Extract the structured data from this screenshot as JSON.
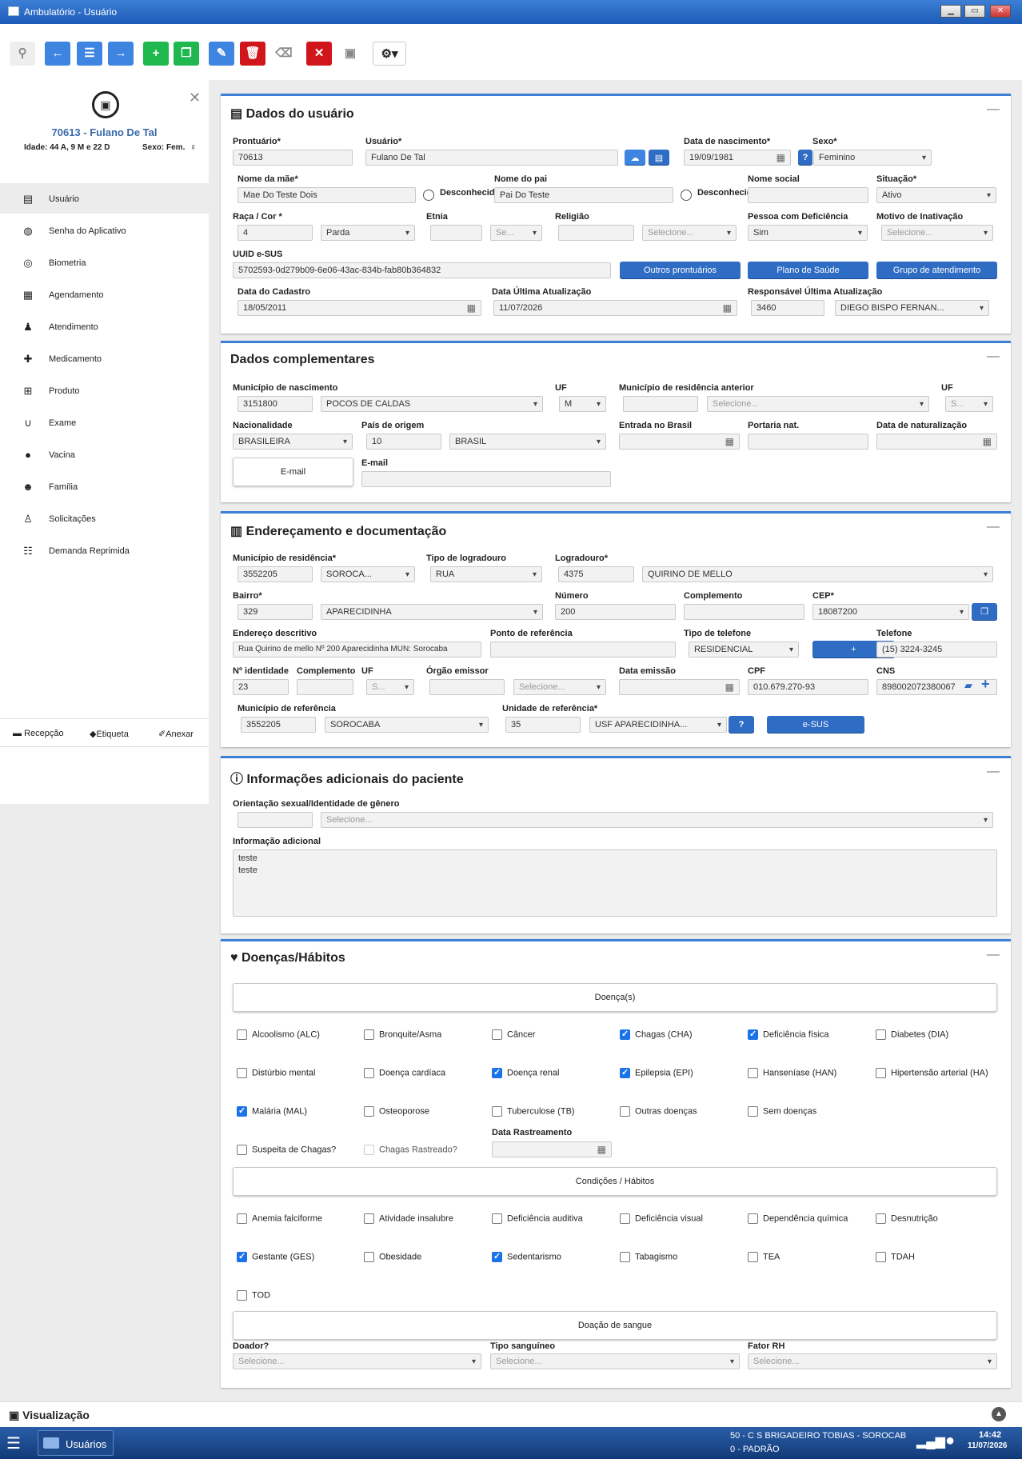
{
  "window": {
    "title": "Ambulatório - Usuário"
  },
  "patient": {
    "header": "70613 - Fulano De Tal",
    "age": "Idade: 44 A, 9 M e 22 D",
    "sex": "Sexo: Fem."
  },
  "sidebar": {
    "items": [
      "Usuário",
      "Senha do Aplicativo",
      "Biometria",
      "Agendamento",
      "Atendimento",
      "Medicamento",
      "Produto",
      "Exame",
      "Vacina",
      "Família",
      "Solicitações",
      "Demanda Reprimida"
    ],
    "bottom": [
      "Recepção",
      "Etiqueta",
      "Anexar"
    ]
  },
  "dados": {
    "title": "Dados do usuário",
    "labels": {
      "prontuario": "Prontuário*",
      "usuario": "Usuário*",
      "nasc": "Data de nascimento*",
      "sexo": "Sexo*",
      "mae": "Nome da mãe*",
      "pai": "Nome do pai",
      "social": "Nome social",
      "situacao": "Situação*",
      "raca": "Raça / Cor *",
      "etnia": "Etnia",
      "religiao": "Religião",
      "pcd": "Pessoa com Deficiência",
      "motivo": "Motivo de Inativação",
      "uuid": "UUID e-SUS",
      "cadastro": "Data do Cadastro",
      "ultima": "Data Última Atualização",
      "resp": "Responsável Última Atualização",
      "desc1": "Desconhecido",
      "desc2": "Desconhecido"
    },
    "values": {
      "prontuario": "70613",
      "usuario": "Fulano De Tal",
      "nasc": "19/09/1981",
      "sexo": "Feminino",
      "mae": "Mae Do Teste Dois",
      "pai": "Pai Do Teste",
      "situacao": "Ativo",
      "raca_code": "4",
      "raca": "Parda",
      "etnia_sel": "Se...",
      "religiao_sel": "Selecione...",
      "pcd": "Sim",
      "motivo": "Selecione...",
      "uuid": "5702593-0d279b09-6e06-43ac-834b-fab80b364832",
      "cadastro": "18/05/2011",
      "ultima": "11/07/2026",
      "resp_code": "3460",
      "resp": "DIEGO BISPO FERNAN..."
    },
    "buttons": {
      "outros": "Outros prontuários",
      "plano": "Plano de Saúde",
      "grupo": "Grupo de atendimento"
    }
  },
  "comp": {
    "title": "Dados complementares",
    "labels": {
      "mun_nasc": "Município de nascimento",
      "uf": "UF",
      "mun_ant": "Município de residência anterior",
      "uf2": "UF",
      "nac": "Nacionalidade",
      "pais": "País de origem",
      "entrada": "Entrada no Brasil",
      "portaria": "Portaria nat.",
      "natural": "Data de naturalização",
      "email": "E-mail"
    },
    "values": {
      "mun_code": "3151800",
      "mun": "POCOS DE CALDAS",
      "uf": "M",
      "mun_ant": "Selecione...",
      "uf2": "S...",
      "nac": "BRASILEIRA",
      "pais_code": "10",
      "pais": "BRASIL"
    },
    "email_button": "E-mail"
  },
  "end": {
    "title": "Endereçamento e documentação",
    "labels": {
      "mun_res": "Município de residência*",
      "tipo_log": "Tipo de logradouro",
      "log": "Logradouro*",
      "bairro": "Bairro*",
      "numero": "Número",
      "compl": "Complemento",
      "cep": "CEP*",
      "end_desc": "Endereço descritivo",
      "ponto": "Ponto de referência",
      "tipo_tel": "Tipo de telefone",
      "tel": "Telefone",
      "rg": "Nº identidade",
      "compl2": "Complemento",
      "uf": "UF",
      "orgao": "Órgão emissor",
      "emissao": "Data emissão",
      "cpf": "CPF",
      "cns": "CNS",
      "mun_ref": "Município de referência",
      "unid_ref": "Unidade de referência*"
    },
    "values": {
      "mun_code": "3552205",
      "mun": "SOROCA...",
      "tipo_log": "RUA",
      "log_code": "4375",
      "log": "QUIRINO DE MELLO",
      "bairro_code": "329",
      "bairro": "APARECIDINHA",
      "numero": "200",
      "cep": "18087200",
      "end_desc": "Rua Quirino de mello  Nº 200  Aparecidinha  MUN: Sorocaba",
      "tipo_tel": "RESIDENCIAL",
      "tel": "(15) 3224-3245",
      "rg": "23",
      "uf": "S...",
      "orgao_sel": "Selecione...",
      "cpf": "010.679.270-93",
      "cns": "898002072380067",
      "mun_ref_code": "3552205",
      "mun_ref": "SOROCABA",
      "unid_code": "35",
      "unid": "USF APARECIDINHA..."
    },
    "buttons": {
      "plus": "+",
      "esus": "e-SUS"
    }
  },
  "info": {
    "title": "Informações adicionais do paciente",
    "lbl_orient": "Orientação sexual/Identidade de gênero",
    "orient": "Selecione...",
    "lbl_add": "Informação adicional",
    "add_lines": [
      "teste",
      "teste"
    ]
  },
  "doencas": {
    "title": "Doenças/Hábitos",
    "sec1": "Doença(s)",
    "sec2": "Condições / Hábitos",
    "sec3": "Doação de sangue",
    "diseases": [
      {
        "label": "Alcoolismo (ALC)",
        "checked": false
      },
      {
        "label": "Bronquite/Asma",
        "checked": false
      },
      {
        "label": "Câncer",
        "checked": false
      },
      {
        "label": "Chagas (CHA)",
        "checked": true
      },
      {
        "label": "Deficiência física",
        "checked": true
      },
      {
        "label": "Diabetes (DIA)",
        "checked": false
      },
      {
        "label": "Distúrbio mental",
        "checked": false
      },
      {
        "label": "Doença cardíaca",
        "checked": false
      },
      {
        "label": "Doença renal",
        "checked": true
      },
      {
        "label": "Epilepsia (EPI)",
        "checked": true
      },
      {
        "label": "Hanseníase (HAN)",
        "checked": false
      },
      {
        "label": "Hipertensão arterial (HA)",
        "checked": false
      },
      {
        "label": "Malária (MAL)",
        "checked": true
      },
      {
        "label": "Osteoporose",
        "checked": false
      },
      {
        "label": "Tuberculose (TB)",
        "checked": false
      },
      {
        "label": "Outras doenças",
        "checked": false
      },
      {
        "label": "Sem doenças",
        "checked": false
      }
    ],
    "suspeita": "Suspeita de Chagas?",
    "rastreado": "Chagas Rastreado?",
    "lbl_rast": "Data Rastreamento",
    "habits": [
      {
        "label": "Anemia falciforme",
        "checked": false
      },
      {
        "label": "Atividade insalubre",
        "checked": false
      },
      {
        "label": "Deficiência auditiva",
        "checked": false
      },
      {
        "label": "Deficiência visual",
        "checked": false
      },
      {
        "label": "Dependência química",
        "checked": false
      },
      {
        "label": "Desnutrição",
        "checked": false
      },
      {
        "label": "Gestante (GES)",
        "checked": true
      },
      {
        "label": "Obesidade",
        "checked": false
      },
      {
        "label": "Sedentarismo",
        "checked": true
      },
      {
        "label": "Tabagismo",
        "checked": false
      },
      {
        "label": "TEA",
        "checked": false
      },
      {
        "label": "TDAH",
        "checked": false
      },
      {
        "label": "TOD",
        "checked": false
      }
    ],
    "lbl_doador": "Doador?",
    "lbl_tipo": "Tipo sanguíneo",
    "lbl_fator": "Fator RH",
    "doador": "Selecione...",
    "tipo": "Selecione...",
    "fator": "Selecione..."
  },
  "bottom": {
    "label": "Visualização"
  },
  "taskbar": {
    "app": "Usuários",
    "unit": "50 - C S BRIGADEIRO TOBIAS - SOROCAB",
    "profile": "0 - PADRÃO",
    "time": "14:42",
    "date": "11/07/2026"
  },
  "colors": {
    "accent": "#3d7fd6",
    "button": "#2f6cc4",
    "green": "#1fb84f",
    "red": "#d1161b"
  }
}
